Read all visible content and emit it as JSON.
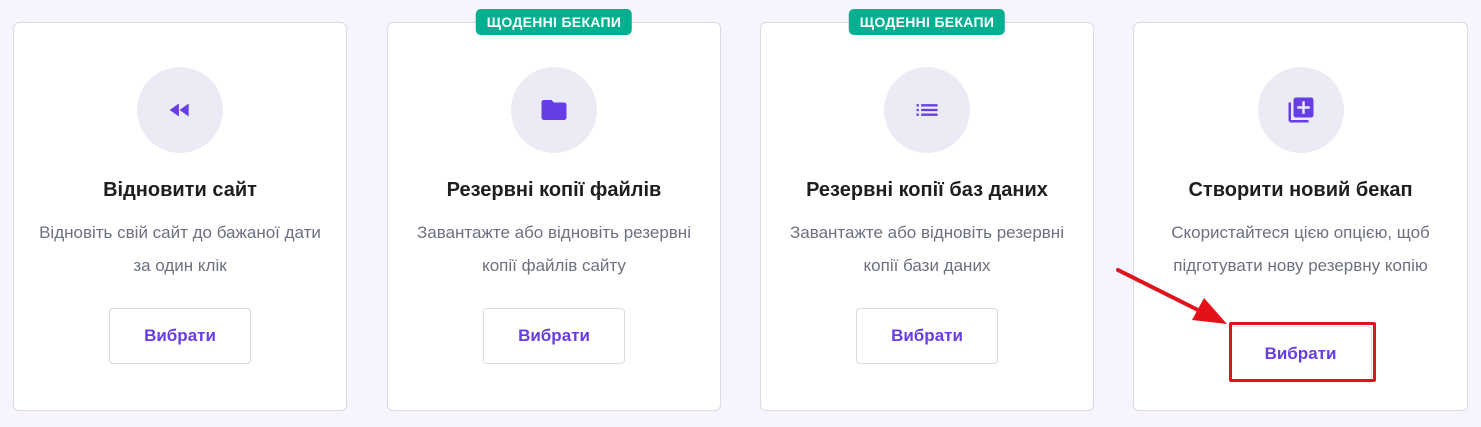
{
  "cards": [
    {
      "badge": "",
      "icon": "rewind-icon",
      "title": "Відновити сайт",
      "description": "Відновіть свій сайт до бажаної дати за один клік",
      "button_label": "Вибрати"
    },
    {
      "badge": "ЩОДЕННІ БЕКАПИ",
      "icon": "folder-icon",
      "title": "Резервні копії файлів",
      "description": "Завантажте або відновіть резервні копії файлів сайту",
      "button_label": "Вибрати"
    },
    {
      "badge": "ЩОДЕННІ БЕКАПИ",
      "icon": "list-icon",
      "title": "Резервні копії баз даних",
      "description": "Завантажте або відновіть резервні копії бази даних",
      "button_label": "Вибрати"
    },
    {
      "badge": "",
      "icon": "library-add-icon",
      "title": "Створити новий бекап",
      "description": "Скористайтеся цією опцією, щоб підготувати нову резервну копію",
      "button_label": "Вибрати"
    }
  ],
  "colors": {
    "accent": "#673de6",
    "badge": "#00b090",
    "annotation": "#e3111a",
    "background": "#f4f5ff"
  }
}
